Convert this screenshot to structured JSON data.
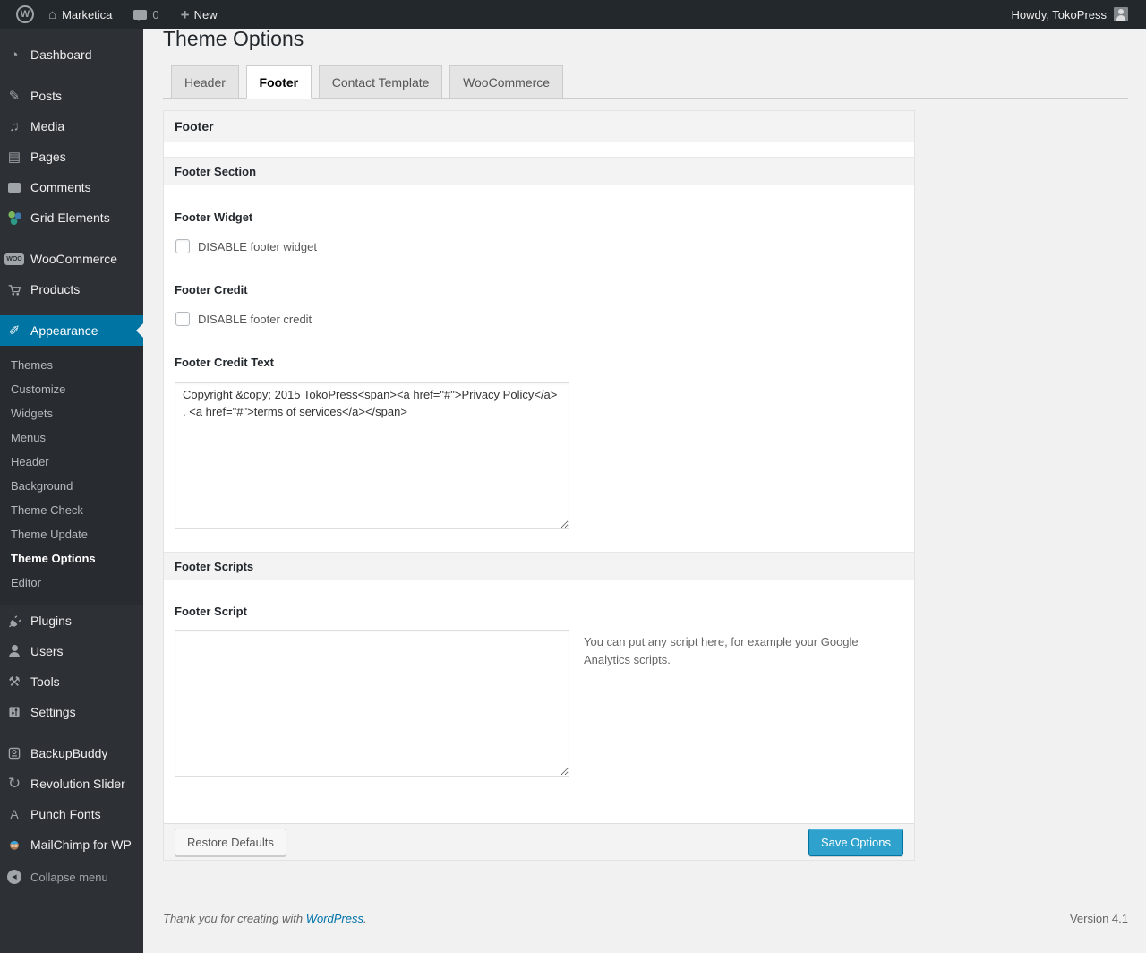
{
  "admin_bar": {
    "site_name": "Marketica",
    "comment_count": "0",
    "new_label": "New",
    "howdy": "Howdy, TokoPress"
  },
  "icons": {
    "wp_logo": "W",
    "home": "⌂",
    "plus": "+",
    "dashboard": "◔",
    "posts": "✎",
    "media": "♫",
    "pages": "▤",
    "appearance": "✐",
    "tools": "⚒",
    "revolution": "↻",
    "punch_fonts": "A",
    "collapse": "◀",
    "woocommerce_badge": "WOO"
  },
  "sidebar": {
    "items": [
      {
        "label": "Dashboard"
      },
      {
        "label": "Posts"
      },
      {
        "label": "Media"
      },
      {
        "label": "Pages"
      },
      {
        "label": "Comments"
      },
      {
        "label": "Grid Elements"
      },
      {
        "label": "WooCommerce"
      },
      {
        "label": "Products"
      },
      {
        "label": "Appearance"
      },
      {
        "label": "Plugins"
      },
      {
        "label": "Users"
      },
      {
        "label": "Tools"
      },
      {
        "label": "Settings"
      },
      {
        "label": "BackupBuddy"
      },
      {
        "label": "Revolution Slider"
      },
      {
        "label": "Punch Fonts"
      },
      {
        "label": "MailChimp for WP"
      }
    ],
    "appearance_submenu": [
      {
        "label": "Themes"
      },
      {
        "label": "Customize"
      },
      {
        "label": "Widgets"
      },
      {
        "label": "Menus"
      },
      {
        "label": "Header"
      },
      {
        "label": "Background"
      },
      {
        "label": "Theme Check"
      },
      {
        "label": "Theme Update"
      },
      {
        "label": "Theme Options",
        "current": true
      },
      {
        "label": "Editor"
      }
    ],
    "collapse_label": "Collapse menu"
  },
  "page": {
    "title": "Theme Options",
    "tabs": [
      {
        "label": "Header"
      },
      {
        "label": "Footer",
        "active": true
      },
      {
        "label": "Contact Template"
      },
      {
        "label": "WooCommerce"
      }
    ]
  },
  "panel": {
    "box_title": "Footer",
    "section_title": "Footer Section",
    "footer_widget_label": "Footer Widget",
    "footer_widget_checkbox": "DISABLE footer widget",
    "footer_credit_label": "Footer Credit",
    "footer_credit_checkbox": "DISABLE footer credit",
    "footer_credit_text_label": "Footer Credit Text",
    "footer_credit_text_value": "Copyright &copy; 2015 TokoPress<span><a href=\"#\">Privacy Policy</a> . <a href=\"#\">terms of services</a></span>",
    "scripts_section_title": "Footer Scripts",
    "footer_script_label": "Footer Script",
    "footer_script_value": "",
    "footer_script_help": "You can put any script here, for example your Google Analytics scripts.",
    "restore_button": "Restore Defaults",
    "save_button": "Save Options"
  },
  "page_footer": {
    "thanks_text": "Thank you for creating with",
    "wordpress_link": "WordPress",
    "period": ".",
    "version": "Version 4.1"
  },
  "colors": {
    "accent": "#0074a2",
    "primary_button": "#2ea2cc",
    "admin_bar": "#23282d",
    "sidebar": "#2d3136",
    "link": "#0073aa",
    "page_bg": "#f1f1f1"
  }
}
